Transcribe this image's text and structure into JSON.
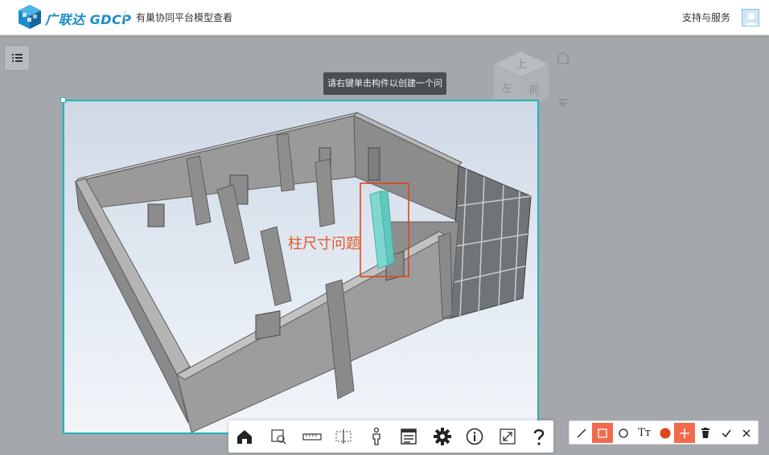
{
  "header": {
    "brand": "广联达 GDCP",
    "subtitle": "有巢协同平台模型查看",
    "support": "支持与服务"
  },
  "tooltip": "请右键单击构件以创建一个问题",
  "viewcube": {
    "top_face": "上",
    "front_face": "前",
    "left_face": "左"
  },
  "annotation": {
    "label": "柱尺寸问题",
    "color": "#e05a2b"
  },
  "toolbar": {
    "items": [
      "home-icon",
      "zoom-window-icon",
      "measure-icon",
      "section-icon",
      "walk-person-icon",
      "model-browser-icon",
      "settings-gear-icon",
      "info-icon",
      "fullscreen-icon",
      "help-icon"
    ]
  },
  "anno_bar": {
    "items": [
      "line-tool-icon",
      "rectangle-tool-icon",
      "circle-tool-icon",
      "text-tool",
      "color-picker",
      "add-icon",
      "delete-trash-icon",
      "confirm-check-icon",
      "close-x-icon"
    ],
    "text_label": "Tт",
    "active_color": "#f26a4c",
    "pen_color": "#e0451c"
  },
  "colors": {
    "accent": "#21b4bd",
    "brand": "#1b8dc9"
  }
}
